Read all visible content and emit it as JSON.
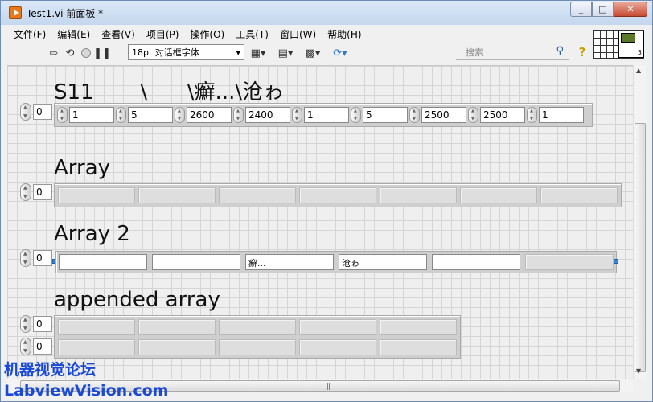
{
  "window": {
    "title": "Test1.vi 前面板 *",
    "minimize": "_",
    "restore": "□",
    "close": "✕"
  },
  "menu": [
    "文件(F)",
    "编辑(E)",
    "查看(V)",
    "项目(P)",
    "操作(O)",
    "工具(T)",
    "窗口(W)",
    "帮助(H)"
  ],
  "toolbar": {
    "font": "18pt 对话框字体",
    "search_placeholder": "搜索",
    "vi_icon_number": "3",
    "icons": [
      "run-arrow-icon",
      "run-continuous-icon",
      "abort-icon",
      "pause-icon",
      "align-icon",
      "distribute-icon",
      "resize-icon",
      "reorder-icon",
      "help-icon",
      "search-icon"
    ]
  },
  "controls": {
    "s11": {
      "label": "S11       \\      \\癬...\\沧ゎ",
      "index": "0",
      "values": [
        "1",
        "5",
        "2600",
        "2400",
        "1",
        "5",
        "2500",
        "2500",
        "1"
      ]
    },
    "array": {
      "label": "Array",
      "index": "0"
    },
    "array2": {
      "label": "Array 2",
      "index": "0",
      "values": [
        "",
        "",
        "癬...",
        "沧ゎ",
        "",
        ""
      ]
    },
    "appended": {
      "label": "appended array",
      "index_row": "0",
      "index_col": "0"
    }
  },
  "watermark": {
    "line1": "机器视觉论坛",
    "line2": "LabviewVision.com"
  },
  "colors": {
    "watermark": "#1a49d6",
    "title_bar": "#c4d7ee",
    "close_button": "#c74b32"
  }
}
